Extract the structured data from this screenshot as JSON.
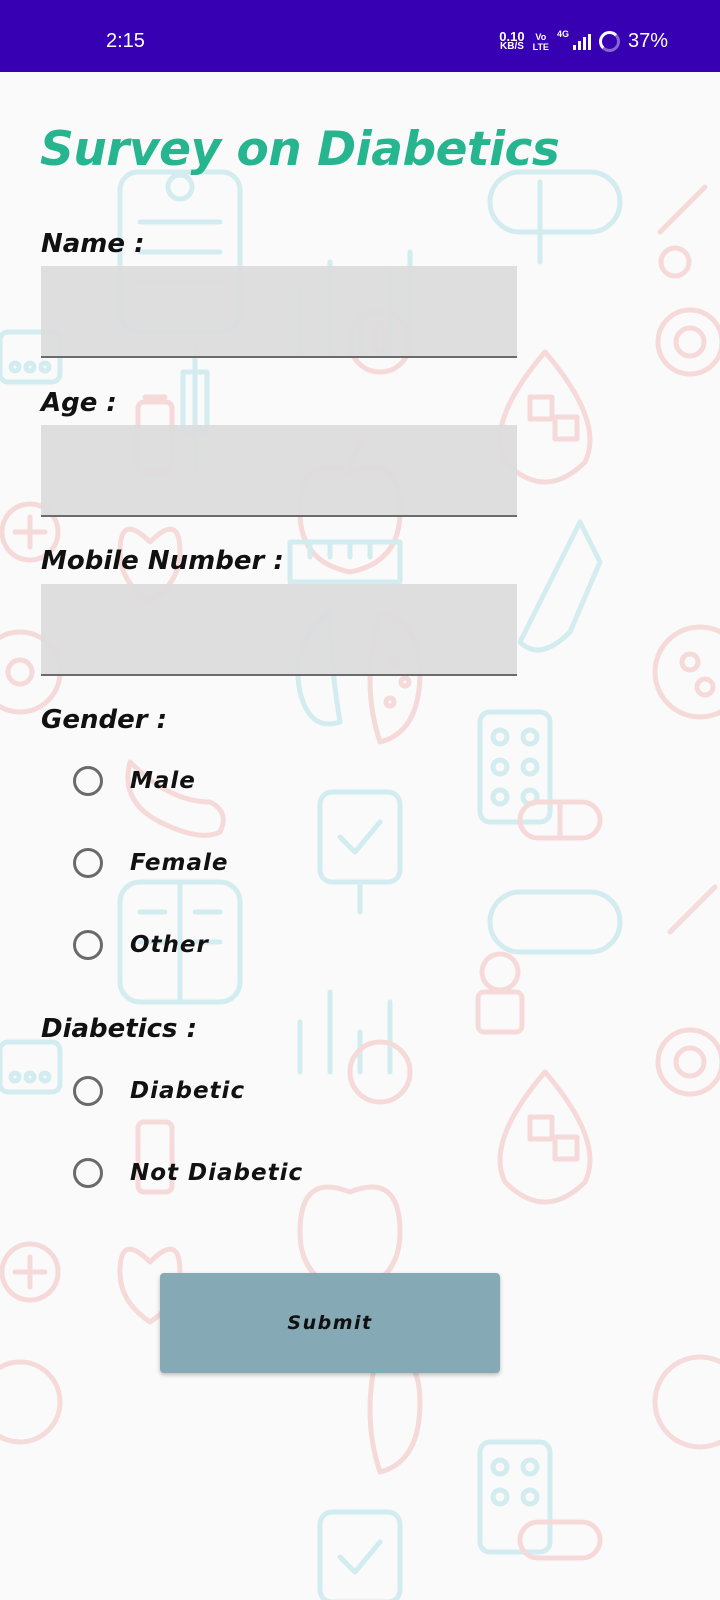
{
  "status_bar": {
    "time": "2:15",
    "net_speed_value": "0.10",
    "net_speed_unit": "KB/S",
    "volte_top": "Vo",
    "volte_bottom": "LTE",
    "network": "4G",
    "battery": "37%"
  },
  "form": {
    "title": "Survey on Diabetics",
    "name_label": "Name :",
    "name_value": "",
    "age_label": "Age :",
    "age_value": "",
    "mobile_label": "Mobile Number :",
    "mobile_value": "",
    "gender_label": "Gender :",
    "gender_options": [
      "Male",
      "Female",
      "Other"
    ],
    "diabetics_label": "Diabetics :",
    "diabetics_options": [
      "Diabetic",
      "Not Diabetic"
    ],
    "submit_label": "Submit"
  },
  "colors": {
    "status_bar": "#3700b3",
    "title": "#26b58f",
    "submit_button": "#85aab6",
    "field_background": "#dcdcdc"
  }
}
